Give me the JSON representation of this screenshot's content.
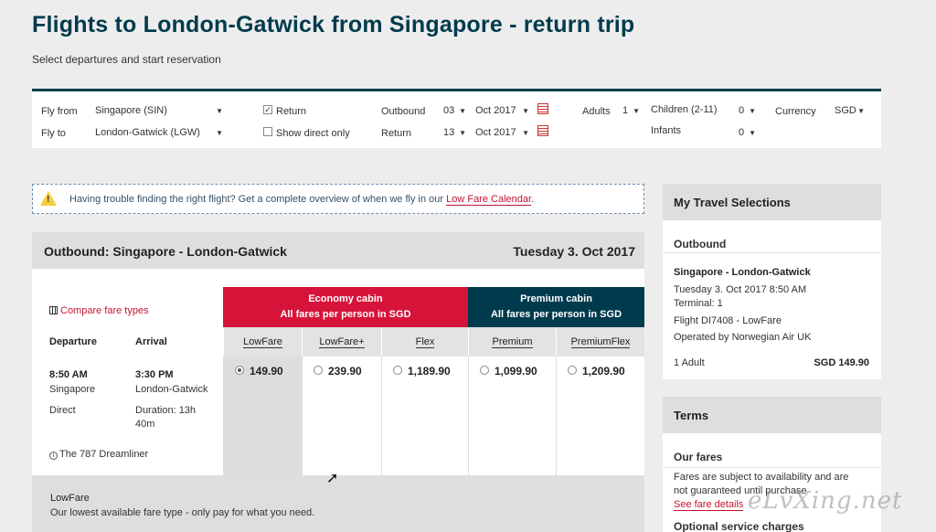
{
  "page": {
    "title": "Flights to London-Gatwick from Singapore - return trip",
    "subtitle": "Select departures and start reservation"
  },
  "search": {
    "fly_from_label": "Fly from",
    "fly_from_value": "Singapore (SIN)",
    "fly_to_label": "Fly to",
    "fly_to_value": "London-Gatwick (LGW)",
    "return_label": "Return",
    "return_checked": true,
    "direct_label": "Show direct only",
    "direct_checked": false,
    "outbound_label": "Outbound",
    "outbound_day": "03",
    "outbound_month": "Oct 2017",
    "return_date_label": "Return",
    "return_day": "13",
    "return_month": "Oct 2017",
    "adults_label": "Adults",
    "adults_value": "1",
    "children_label": "Children (2-11)",
    "children_value": "0",
    "infants_label": "Infants",
    "infants_value": "0",
    "currency_label": "Currency",
    "currency_value": "SGD"
  },
  "notice": {
    "text": "Having trouble finding the right flight? Get a complete overview of when we fly in our ",
    "link": "Low Fare Calendar",
    "end": "."
  },
  "flight": {
    "title": "Outbound:  Singapore - London-Gatwick",
    "date": "Tuesday 3. Oct 2017",
    "compare_link": "Compare fare types",
    "departure_header": "Departure",
    "arrival_header": "Arrival",
    "dep_time": "8:50 AM",
    "dep_city": "Singapore",
    "arr_time": "3:30 PM",
    "arr_city": "London-Gatwick",
    "stops": "Direct",
    "duration_line1": "Duration: 13h",
    "duration_line2": "40m",
    "aircraft": "The 787 Dreamliner",
    "economy_cabin": "Economy cabin",
    "economy_sub": "All fares per person in SGD",
    "premium_cabin": "Premium cabin",
    "premium_sub": "All fares per person in SGD",
    "fares": [
      {
        "name": "LowFare",
        "price": "149.90",
        "selected": true
      },
      {
        "name": "LowFare+",
        "price": "239.90",
        "selected": false
      },
      {
        "name": "Flex",
        "price": "1,189.90",
        "selected": false
      },
      {
        "name": "Premium",
        "price": "1,099.90",
        "selected": false
      },
      {
        "name": "PremiumFlex",
        "price": "1,209.90",
        "selected": false
      }
    ],
    "fare_desc_title": "LowFare",
    "fare_desc_text": "Our lowest available fare type - only pay for what you need."
  },
  "travel": {
    "heading": "My Travel Selections",
    "outbound_label": "Outbound",
    "route": "Singapore - London-Gatwick",
    "datetime": "Tuesday 3. Oct 2017 8:50 AM",
    "terminal": "Terminal: 1",
    "flight": "Flight DI7408 - LowFare",
    "operator": "Operated by Norwegian Air UK",
    "pax": "1 Adult",
    "total": "SGD 149.90"
  },
  "terms": {
    "heading": "Terms",
    "fares_heading": "Our fares",
    "fares_text1": "Fares are subject to availability and are",
    "fares_text2": "not guaranteed until purchase",
    "fares_link": "See fare details",
    "optional_heading": "Optional service charges"
  },
  "watermark": "eLvXing.net",
  "colors": {
    "brand_navy": "#003b4d",
    "economy_red": "#d6143a",
    "link_red": "#c41230"
  }
}
